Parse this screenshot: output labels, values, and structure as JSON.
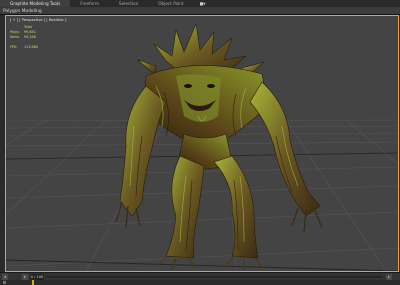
{
  "ribbon": {
    "tabs": [
      {
        "label": "Graphite Modeling Tools",
        "active": true
      },
      {
        "label": "Freeform",
        "active": false
      },
      {
        "label": "Selection",
        "active": false
      },
      {
        "label": "Object Paint",
        "active": false
      }
    ],
    "menu_glyph": "■▾",
    "panel_label": "Polygon Modeling"
  },
  "viewport": {
    "label": "[ + ] [ Perspective ] [ Realistic ]",
    "stats": {
      "total_label": "Total",
      "polys_label": "Polys:",
      "polys_value": "99,641",
      "verts_label": "Verts:",
      "verts_value": "99,346",
      "fps_label": "FPS:",
      "fps_value": "113.680"
    },
    "border_color": "#f0a020"
  },
  "timeline": {
    "frame_readout": "0 / 100",
    "prev_glyph": "◂",
    "next_glyph": "▸"
  },
  "colors": {
    "bark_dark": "#3a2a14",
    "bark_mid": "#6b5a22",
    "moss": "#8a9a2a",
    "moss_light": "#a8b838",
    "status_accent": "#d8b000"
  }
}
